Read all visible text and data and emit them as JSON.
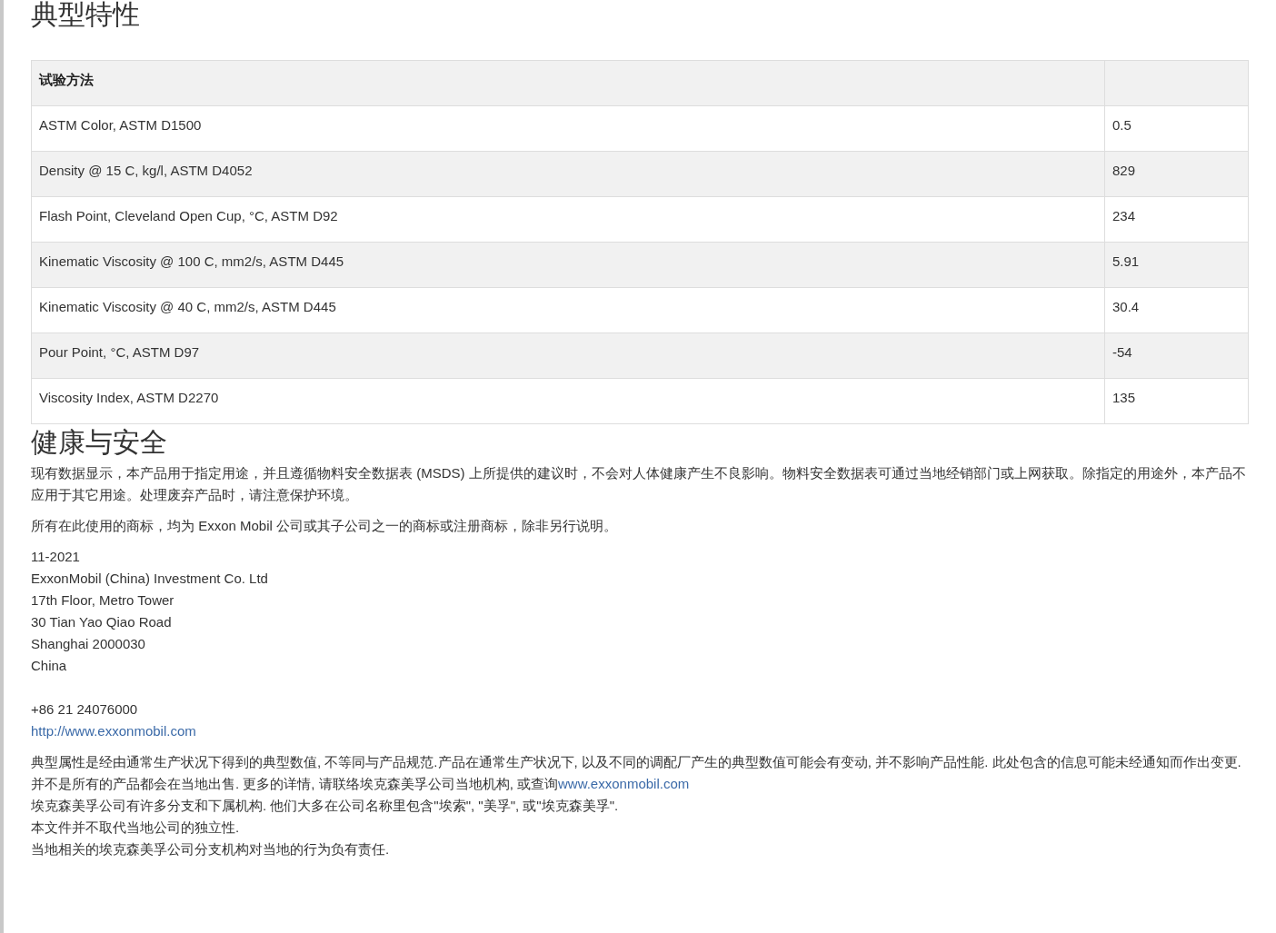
{
  "properties": {
    "title": "典型特性",
    "header": "试验方法",
    "rows": [
      {
        "name": "ASTM Color, ASTM D1500",
        "value": "0.5"
      },
      {
        "name": "Density @ 15 C, kg/l, ASTM D4052",
        "value": "829"
      },
      {
        "name": "Flash Point, Cleveland Open Cup, °C, ASTM D92",
        "value": "234"
      },
      {
        "name": "Kinematic Viscosity @ 100 C, mm2/s, ASTM D445",
        "value": "5.91"
      },
      {
        "name": "Kinematic Viscosity @ 40 C, mm2/s, ASTM D445",
        "value": "30.4"
      },
      {
        "name": "Pour Point, °C, ASTM D97",
        "value": "-54"
      },
      {
        "name": "Viscosity Index, ASTM D2270",
        "value": "135"
      }
    ]
  },
  "health": {
    "title": "健康与安全",
    "paragraphs": [
      "现有数据显示，本产品用于指定用途，并且遵循物料安全数据表 (MSDS) 上所提供的建议时，不会对人体健康产生不良影响。物料安全数据表可通过当地经销部门或上网获取。除指定的用途外，本产品不应用于其它用途。处理废弃产品时，请注意保护环境。",
      "所有在此使用的商标，均为 Exxon Mobil 公司或其子公司之一的商标或注册商标，除非另行说明。"
    ],
    "contact": {
      "lines": [
        "11-2021",
        "ExxonMobil (China) Investment Co. Ltd",
        "17th Floor, Metro Tower",
        "30 Tian Yao Qiao Road",
        "Shanghai 2000030",
        "China"
      ],
      "phone": "+86 21 24076000",
      "url": "http://www.exxonmobil.com"
    },
    "disclaimer": {
      "text": "典型属性是经由通常生产状况下得到的典型数值, 不等同与产品规范.产品在通常生产状况下, 以及不同的调配厂产生的典型数值可能会有变动, 并不影响产品性能. 此处包含的信息可能未经通知而作出变更. 并不是所有的产品都会在当地出售.  更多的详情, 请联络埃克森美孚公司当地机构, 或查询",
      "link": "www.exxonmobil.com",
      "lines": [
        "埃克森美孚公司有许多分支和下属机构. 他们大多在公司名称里包含\"埃索\", \"美孚\", 或\"埃克森美孚\".",
        "本文件并不取代当地公司的独立性.",
        "当地相关的埃克森美孚公司分支机构对当地的行为负有责任."
      ]
    }
  }
}
